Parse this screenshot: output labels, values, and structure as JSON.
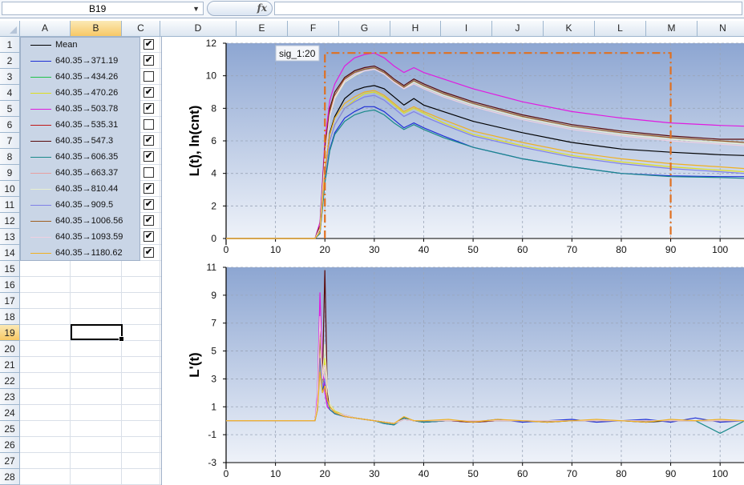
{
  "formula_bar": {
    "cell_ref": "B19",
    "fx_label": "fx",
    "formula_value": ""
  },
  "columns": [
    {
      "label": "A",
      "active": false
    },
    {
      "label": "B",
      "active": true
    },
    {
      "label": "C",
      "active": false
    },
    {
      "label": "D",
      "active": false
    },
    {
      "label": "E",
      "active": false
    },
    {
      "label": "F",
      "active": false
    },
    {
      "label": "G",
      "active": false
    },
    {
      "label": "H",
      "active": false
    },
    {
      "label": "I",
      "active": false
    },
    {
      "label": "J",
      "active": false
    },
    {
      "label": "K",
      "active": false
    },
    {
      "label": "L",
      "active": false
    },
    {
      "label": "M",
      "active": false
    },
    {
      "label": "N",
      "active": false
    }
  ],
  "rows": [
    "1",
    "2",
    "3",
    "4",
    "5",
    "6",
    "7",
    "8",
    "9",
    "10",
    "11",
    "12",
    "13",
    "14",
    "15",
    "16",
    "17",
    "18",
    "19",
    "20",
    "21",
    "22",
    "23",
    "24",
    "25",
    "26",
    "27",
    "28"
  ],
  "active_row": "19",
  "legend": [
    {
      "label": "Mean",
      "color": "#000000",
      "checked": true
    },
    {
      "label": "640.35→371.19",
      "color": "#1f2fd6",
      "checked": true
    },
    {
      "label": "640.35→434.26",
      "color": "#22c34a",
      "checked": false
    },
    {
      "label": "640.35→470.26",
      "color": "#dede1e",
      "checked": true
    },
    {
      "label": "640.35→503.78",
      "color": "#e01ae0",
      "checked": true
    },
    {
      "label": "640.35→535.31",
      "color": "#c01818",
      "checked": false
    },
    {
      "label": "640.35→547.3",
      "color": "#5a0a0a",
      "checked": true
    },
    {
      "label": "640.35→606.35",
      "color": "#1a8a8a",
      "checked": true
    },
    {
      "label": "640.35→663.37",
      "color": "#e8a0a0",
      "checked": false
    },
    {
      "label": "640.35→810.44",
      "color": "#e8f0d0",
      "checked": true
    },
    {
      "label": "640.35→909.5",
      "color": "#8080e8",
      "checked": true
    },
    {
      "label": "640.35→1006.56",
      "color": "#a06020",
      "checked": true
    },
    {
      "label": "640.35→1093.59",
      "color": "#f0d0e0",
      "checked": true
    },
    {
      "label": "640.35→1180.62",
      "color": "#f0b020",
      "checked": true
    }
  ],
  "chart_data": [
    {
      "type": "line",
      "ylabel": "L(t), ln(cnt)",
      "xlim": [
        0,
        105
      ],
      "ylim": [
        0,
        12
      ],
      "x_ticks": [
        0,
        10,
        20,
        30,
        40,
        50,
        60,
        70,
        80,
        90,
        100
      ],
      "y_ticks": [
        0,
        2,
        4,
        6,
        8,
        10,
        12
      ],
      "annotation": {
        "label": "sig_1:20",
        "x_range": [
          20,
          90
        ],
        "y": 11.4,
        "color": "#e07020"
      },
      "grid": true,
      "x": [
        0,
        18,
        19,
        20,
        21,
        22,
        24,
        26,
        28,
        30,
        32,
        34,
        36,
        38,
        40,
        44,
        50,
        60,
        70,
        80,
        90,
        100,
        105
      ],
      "series": [
        {
          "name": "Mean",
          "color": "#000000",
          "values": [
            0,
            0,
            0.5,
            4,
            6.5,
            7.5,
            8.6,
            9.1,
            9.3,
            9.4,
            9.2,
            8.7,
            8.2,
            8.6,
            8.2,
            7.8,
            7.2,
            6.5,
            5.9,
            5.5,
            5.3,
            5.15,
            5.1
          ]
        },
        {
          "name": "640.35→371.19",
          "color": "#1f2fd6",
          "values": [
            0,
            0,
            0.3,
            3.5,
            5.5,
            6.5,
            7.4,
            7.8,
            8.1,
            8.1,
            7.8,
            7.3,
            6.8,
            7.1,
            6.8,
            6.3,
            5.6,
            4.9,
            4.4,
            4.0,
            3.85,
            3.8,
            3.8
          ]
        },
        {
          "name": "640.35→470.26",
          "color": "#dede1e",
          "values": [
            0,
            0,
            0.4,
            4,
            6,
            7,
            8,
            8.5,
            8.9,
            9.0,
            8.7,
            8.2,
            7.7,
            8.0,
            7.7,
            7.1,
            6.4,
            5.7,
            5.1,
            4.7,
            4.4,
            4.2,
            4.1
          ]
        },
        {
          "name": "640.35→503.78",
          "color": "#e01ae0",
          "values": [
            0,
            0,
            1,
            6,
            8.5,
            9.5,
            10.6,
            11.1,
            11.3,
            11.4,
            11.1,
            10.6,
            10.2,
            10.5,
            10.2,
            9.8,
            9.2,
            8.4,
            7.8,
            7.4,
            7.1,
            6.95,
            6.9
          ]
        },
        {
          "name": "640.35→547.3",
          "color": "#5a0a0a",
          "values": [
            0,
            0,
            0.8,
            5.5,
            8,
            9,
            9.9,
            10.3,
            10.5,
            10.6,
            10.3,
            9.8,
            9.4,
            9.8,
            9.5,
            9.0,
            8.4,
            7.6,
            7.0,
            6.6,
            6.3,
            6.1,
            6.1
          ]
        },
        {
          "name": "640.35→606.35",
          "color": "#1a8a8a",
          "values": [
            0,
            0,
            0.3,
            3.4,
            5.4,
            6.4,
            7.2,
            7.6,
            7.8,
            7.9,
            7.6,
            7.1,
            6.7,
            7.0,
            6.7,
            6.2,
            5.6,
            4.9,
            4.4,
            4.0,
            3.8,
            3.75,
            3.7
          ]
        },
        {
          "name": "640.35→810.44",
          "color": "#e8f0d0",
          "values": [
            0,
            0,
            0.6,
            5,
            7.5,
            8.6,
            9.6,
            10.0,
            10.3,
            10.4,
            10.1,
            9.6,
            9.2,
            9.6,
            9.3,
            8.8,
            8.2,
            7.4,
            6.8,
            6.4,
            6.1,
            5.9,
            5.8
          ]
        },
        {
          "name": "640.35→909.5",
          "color": "#8080e8",
          "values": [
            0,
            0,
            0.4,
            4,
            6,
            7,
            8,
            8.4,
            8.7,
            8.8,
            8.5,
            8.0,
            7.5,
            7.8,
            7.5,
            7.0,
            6.3,
            5.6,
            5.0,
            4.6,
            4.3,
            4.1,
            4.0
          ]
        },
        {
          "name": "640.35→1006.56",
          "color": "#a06020",
          "values": [
            0,
            0,
            0.7,
            5.3,
            7.8,
            8.8,
            9.8,
            10.2,
            10.4,
            10.5,
            10.2,
            9.7,
            9.3,
            9.7,
            9.4,
            8.9,
            8.3,
            7.5,
            6.9,
            6.5,
            6.2,
            6.0,
            5.9
          ]
        },
        {
          "name": "640.35→1093.59",
          "color": "#f0d0e0",
          "values": [
            0,
            0,
            0.6,
            5,
            7.6,
            8.7,
            9.7,
            10.1,
            10.3,
            10.4,
            10.1,
            9.6,
            9.2,
            9.5,
            9.2,
            8.7,
            8.1,
            7.3,
            6.7,
            6.3,
            6.0,
            5.8,
            5.7
          ]
        },
        {
          "name": "640.35→1180.62",
          "color": "#f0b020",
          "values": [
            0,
            0,
            0.4,
            4.2,
            6.4,
            7.4,
            8.3,
            8.7,
            9.0,
            9.1,
            8.8,
            8.3,
            7.8,
            8.1,
            7.8,
            7.3,
            6.6,
            5.9,
            5.3,
            4.9,
            4.6,
            4.4,
            4.3
          ]
        }
      ]
    },
    {
      "type": "line",
      "ylabel": "L'(t)",
      "xlim": [
        0,
        105
      ],
      "ylim": [
        -3,
        11
      ],
      "x_ticks": [
        0,
        10,
        20,
        30,
        40,
        50,
        60,
        70,
        80,
        90,
        100
      ],
      "y_ticks": [
        -3,
        -1,
        1,
        3,
        5,
        7,
        9,
        11
      ],
      "grid": true,
      "x": [
        0,
        18,
        18.5,
        19,
        19.5,
        20,
        20.5,
        21,
        22,
        24,
        26,
        28,
        30,
        32,
        34,
        36,
        38,
        40,
        45,
        50,
        55,
        60,
        65,
        70,
        75,
        80,
        85,
        90,
        95,
        100,
        105
      ],
      "series": [
        {
          "name": "Mean",
          "color": "#000000",
          "values": [
            0,
            0,
            1.5,
            5,
            3,
            2.5,
            1.5,
            1.0,
            0.6,
            0.4,
            0.2,
            0.1,
            0,
            -0.1,
            -0.2,
            0.1,
            0,
            -0.1,
            0,
            -0.1,
            0,
            0,
            -0.1,
            0,
            0,
            0,
            -0.1,
            0,
            0,
            0,
            0
          ]
        },
        {
          "name": "640.35→371.19",
          "color": "#1f2fd6",
          "values": [
            0,
            0,
            1,
            6.5,
            2,
            3,
            1,
            0.8,
            0.5,
            0.3,
            0.2,
            0.1,
            0,
            -0.2,
            -0.3,
            0.2,
            0,
            -0.1,
            0,
            -0.1,
            0.1,
            -0.1,
            0,
            0.1,
            -0.1,
            0,
            0.1,
            -0.1,
            0.2,
            -0.1,
            0
          ]
        },
        {
          "name": "640.35→470.26",
          "color": "#dede1e",
          "values": [
            0,
            0,
            0.8,
            4,
            2.5,
            4.5,
            2,
            1.2,
            0.7,
            0.4,
            0.2,
            0.1,
            0,
            -0.1,
            -0.2,
            0.1,
            0,
            0,
            0,
            -0.1,
            0,
            0,
            0,
            0,
            0,
            0,
            0,
            0,
            0,
            0,
            0
          ]
        },
        {
          "name": "640.35→503.78",
          "color": "#e01ae0",
          "values": [
            0,
            0,
            2,
            9.2,
            4,
            2,
            1,
            0.8,
            0.5,
            0.3,
            0.2,
            0.1,
            0,
            -0.1,
            -0.2,
            0.1,
            0,
            0,
            0,
            -0.1,
            0,
            0,
            0,
            0,
            0,
            0,
            0,
            0,
            0,
            0,
            0
          ]
        },
        {
          "name": "640.35→547.3",
          "color": "#5a0a0a",
          "values": [
            0,
            0,
            1.2,
            7,
            3,
            10.8,
            2,
            1,
            0.6,
            0.4,
            0.2,
            0.1,
            0,
            -0.1,
            -0.2,
            0.2,
            0,
            0,
            0,
            -0.1,
            0,
            0,
            0,
            0,
            0,
            0,
            0,
            0,
            0,
            0,
            0
          ]
        },
        {
          "name": "640.35→606.35",
          "color": "#1a8a8a",
          "values": [
            0,
            0,
            0.8,
            4.5,
            2,
            2.5,
            1.5,
            0.8,
            0.5,
            0.3,
            0.2,
            0.1,
            0,
            -0.2,
            -0.3,
            0.2,
            0,
            -0.1,
            0,
            0,
            0,
            0,
            0,
            0,
            0,
            0,
            0,
            0,
            0,
            -0.9,
            0
          ]
        },
        {
          "name": "640.35→810.44",
          "color": "#e8f0d0",
          "values": [
            0,
            0,
            1,
            5,
            3,
            5.5,
            2.5,
            1.2,
            0.6,
            0.4,
            0.2,
            0.1,
            0,
            -0.1,
            -0.2,
            0.1,
            0,
            0,
            0,
            0,
            0,
            0,
            0,
            0,
            0,
            0,
            0,
            0,
            0,
            0,
            0
          ]
        },
        {
          "name": "640.35→909.5",
          "color": "#8080e8",
          "values": [
            0,
            0,
            1,
            4.5,
            2.5,
            3,
            1.5,
            1,
            0.6,
            0.3,
            0.2,
            0.1,
            0,
            -0.1,
            -0.2,
            0.1,
            0,
            0,
            0,
            0,
            0,
            0,
            0,
            0,
            0,
            0,
            0,
            0,
            0,
            0,
            0
          ]
        },
        {
          "name": "640.35→1006.56",
          "color": "#a06020",
          "values": [
            0,
            0,
            1.5,
            6,
            3,
            4,
            1.5,
            1,
            0.6,
            0.4,
            0.2,
            0.1,
            0,
            -0.1,
            -0.2,
            0.1,
            0,
            0,
            0,
            0,
            0,
            0,
            0,
            0,
            0,
            0,
            0,
            0,
            0,
            0,
            0
          ]
        },
        {
          "name": "640.35→1093.59",
          "color": "#f0d0e0",
          "values": [
            0,
            0,
            1.5,
            7.5,
            3,
            4,
            1.5,
            1,
            0.6,
            0.4,
            0.2,
            0.1,
            0,
            -0.1,
            -0.2,
            0.1,
            0,
            0,
            0,
            0,
            0,
            0,
            0,
            0,
            0,
            0,
            0,
            0,
            0,
            0,
            0
          ]
        },
        {
          "name": "640.35→1180.62",
          "color": "#f0b020",
          "values": [
            0,
            0,
            0.8,
            3.5,
            2,
            2.5,
            1.5,
            1,
            0.6,
            0.3,
            0.2,
            0.1,
            0,
            -0.1,
            -0.2,
            0.3,
            0,
            0,
            0.1,
            -0.1,
            0.1,
            0,
            -0.1,
            0,
            0.1,
            0,
            -0.1,
            0.1,
            0,
            0.1,
            0
          ]
        }
      ]
    }
  ]
}
